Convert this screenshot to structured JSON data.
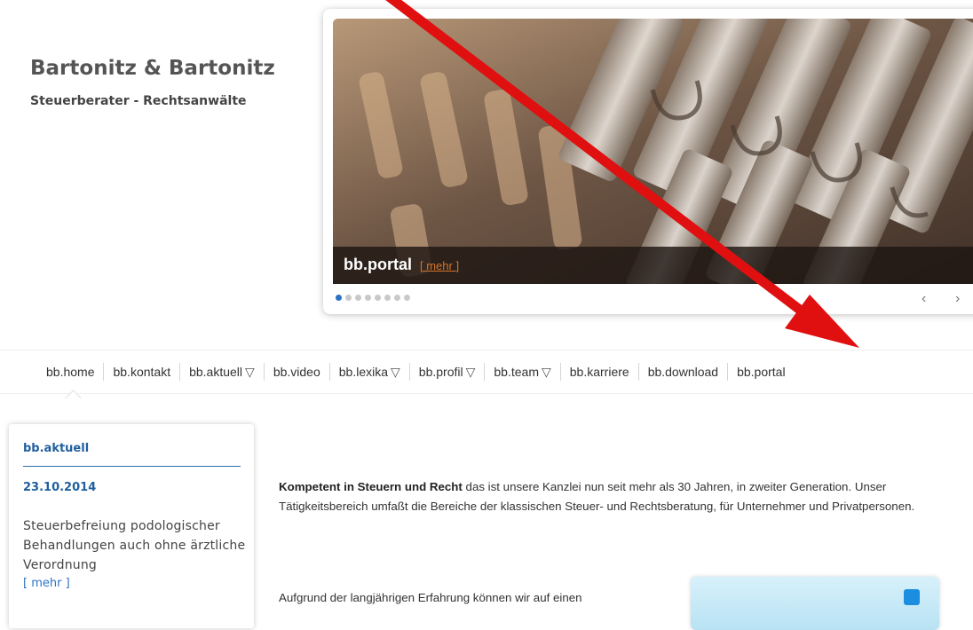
{
  "brand": {
    "name": "Bartonitz & Bartonitz",
    "tagline": "Steuerberater - Rechtsanwälte"
  },
  "slider": {
    "caption_title": "bb.portal",
    "caption_more": "[ mehr ]",
    "slide_count": 8,
    "active_slide": 1,
    "prev": "‹",
    "next": "›"
  },
  "nav": {
    "items": [
      {
        "label": "bb.home",
        "dropdown": false
      },
      {
        "label": "bb.kontakt",
        "dropdown": false
      },
      {
        "label": "bb.aktuell",
        "dropdown": true
      },
      {
        "label": "bb.video",
        "dropdown": false
      },
      {
        "label": "bb.lexika",
        "dropdown": true
      },
      {
        "label": "bb.profil",
        "dropdown": true
      },
      {
        "label": "bb.team",
        "dropdown": true
      },
      {
        "label": "bb.karriere",
        "dropdown": false
      },
      {
        "label": "bb.download",
        "dropdown": false
      },
      {
        "label": "bb.portal",
        "dropdown": false
      }
    ],
    "dropdown_glyph": "▽"
  },
  "news": {
    "heading": "bb.aktuell",
    "date": "23.10.2014",
    "text": "Steuerbefreiung podologischer Behandlungen auch ohne ärztliche Verordnung",
    "more": "[ mehr ]"
  },
  "content": {
    "intro_bold": "Kompetent in Steuern und Recht",
    "intro_rest": " das ist unsere Kanzlei nun seit mehr als 30 Jahren, in zweiter Generation. Unser Tätigkeitsbereich umfaßt die Bereiche der klassischen Steuer- und Rechtsberatung, für Unternehmer und Privatpersonen.",
    "paragraph2": "Aufgrund der langjährigen Erfahrung können wir auf einen"
  },
  "colors": {
    "accent_blue": "#2d73c4",
    "heading_blue": "#1f5f9c",
    "more_orange": "#d6762b",
    "annotation_red": "#e01010"
  }
}
